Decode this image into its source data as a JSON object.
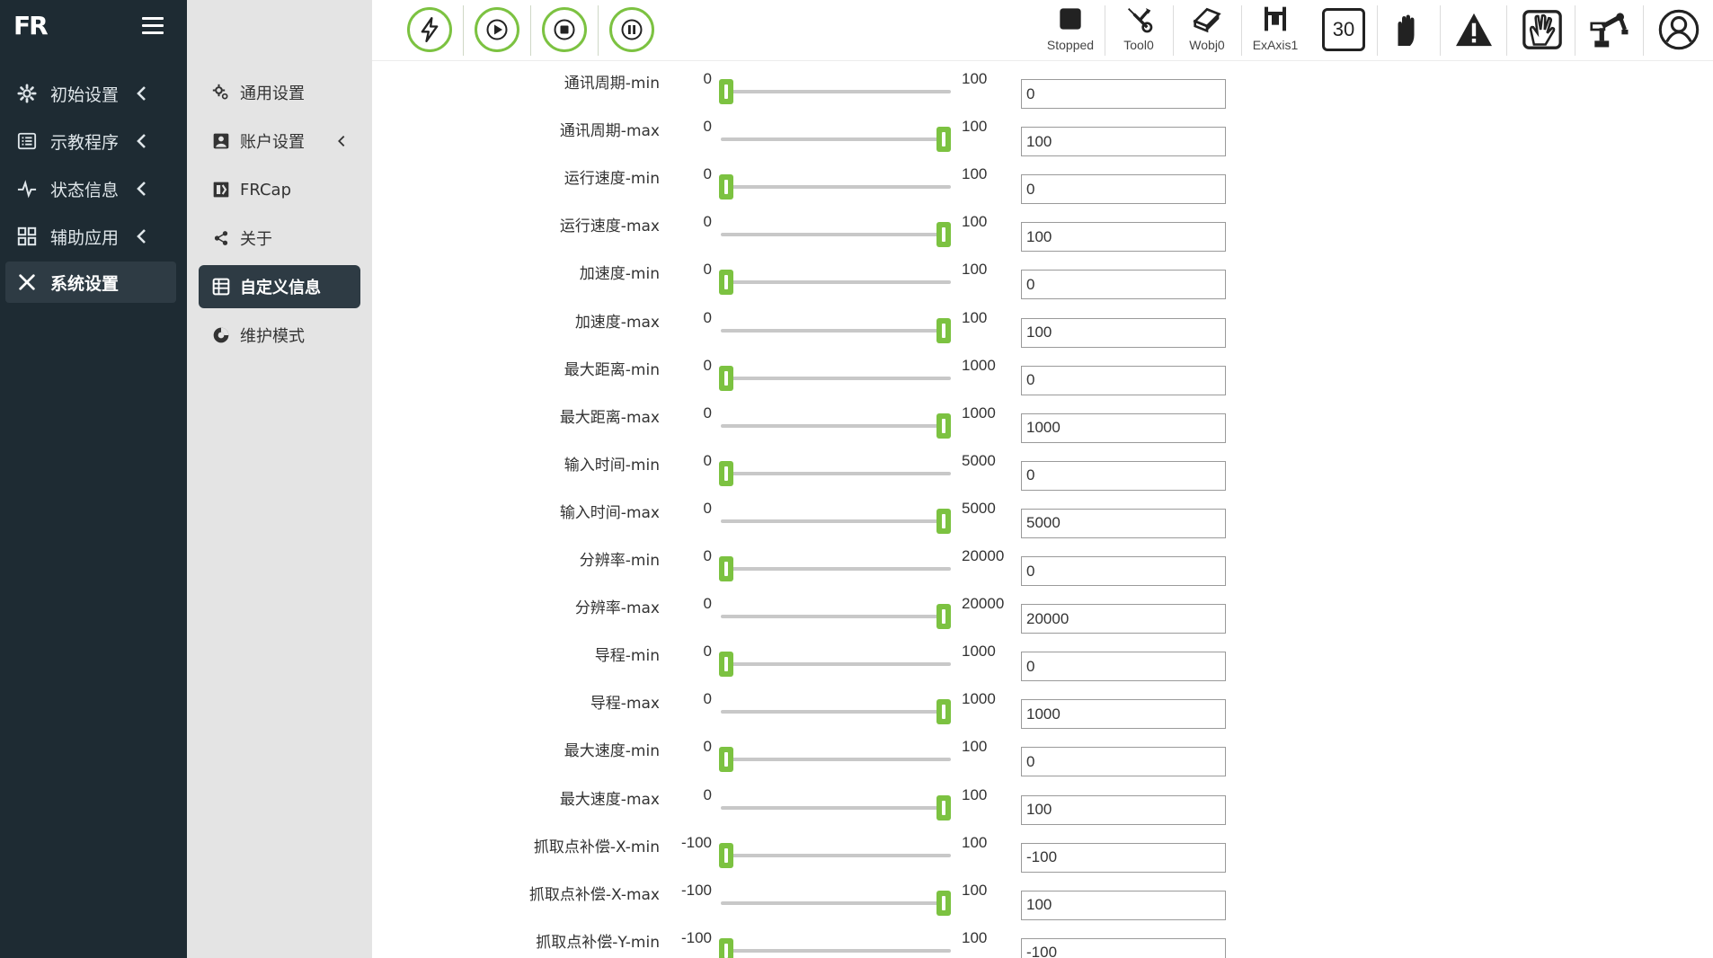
{
  "brand": {
    "logo": "FR"
  },
  "sidebar": {
    "items": [
      {
        "label": "初始设置",
        "icon": "gear-icon"
      },
      {
        "label": "示教程序",
        "icon": "list-icon"
      },
      {
        "label": "状态信息",
        "icon": "pulse-icon"
      },
      {
        "label": "辅助应用",
        "icon": "grid-icon"
      },
      {
        "label": "系统设置",
        "icon": "tools-icon",
        "active": true
      }
    ]
  },
  "submenu": {
    "items": [
      {
        "label": "通用设置",
        "icon": "gears-icon"
      },
      {
        "label": "账户设置",
        "icon": "account-icon",
        "chevron": true
      },
      {
        "label": "FRCap",
        "icon": "frcap-icon"
      },
      {
        "label": "关于",
        "icon": "share-icon"
      },
      {
        "label": "自定义信息",
        "icon": "table-icon",
        "active": true
      },
      {
        "label": "维护模式",
        "icon": "maintenance-icon"
      }
    ]
  },
  "toolbar": {
    "controls": [
      "lightning-icon",
      "play-icon",
      "stop-icon",
      "pause-icon"
    ],
    "status": [
      {
        "label": "Stopped",
        "icon": "stopped-square-icon"
      },
      {
        "label": "Tool0",
        "icon": "wrench-icon"
      },
      {
        "label": "Wobj0",
        "icon": "eraser-icon"
      },
      {
        "label": "ExAxis1",
        "icon": "ex-axis-icon"
      }
    ],
    "speed": "30"
  },
  "colors": {
    "accent": "#7cc241",
    "sidebar_bg": "#1e2b33",
    "submenu_bg": "#e4e4e4",
    "active_bg": "#2e3b44"
  },
  "params": [
    {
      "label": "通讯周期-min",
      "min": "0",
      "max": "100",
      "value": "0",
      "fraction": 0
    },
    {
      "label": "通讯周期-max",
      "min": "0",
      "max": "100",
      "value": "100",
      "fraction": 1
    },
    {
      "label": "运行速度-min",
      "min": "0",
      "max": "100",
      "value": "0",
      "fraction": 0
    },
    {
      "label": "运行速度-max",
      "min": "0",
      "max": "100",
      "value": "100",
      "fraction": 1
    },
    {
      "label": "加速度-min",
      "min": "0",
      "max": "100",
      "value": "0",
      "fraction": 0
    },
    {
      "label": "加速度-max",
      "min": "0",
      "max": "100",
      "value": "100",
      "fraction": 1
    },
    {
      "label": "最大距离-min",
      "min": "0",
      "max": "1000",
      "value": "0",
      "fraction": 0
    },
    {
      "label": "最大距离-max",
      "min": "0",
      "max": "1000",
      "value": "1000",
      "fraction": 1
    },
    {
      "label": "输入时间-min",
      "min": "0",
      "max": "5000",
      "value": "0",
      "fraction": 0
    },
    {
      "label": "输入时间-max",
      "min": "0",
      "max": "5000",
      "value": "5000",
      "fraction": 1
    },
    {
      "label": "分辨率-min",
      "min": "0",
      "max": "20000",
      "value": "0",
      "fraction": 0
    },
    {
      "label": "分辨率-max",
      "min": "0",
      "max": "20000",
      "value": "20000",
      "fraction": 1
    },
    {
      "label": "导程-min",
      "min": "0",
      "max": "1000",
      "value": "0",
      "fraction": 0
    },
    {
      "label": "导程-max",
      "min": "0",
      "max": "1000",
      "value": "1000",
      "fraction": 1
    },
    {
      "label": "最大速度-min",
      "min": "0",
      "max": "100",
      "value": "0",
      "fraction": 0
    },
    {
      "label": "最大速度-max",
      "min": "0",
      "max": "100",
      "value": "100",
      "fraction": 1
    },
    {
      "label": "抓取点补偿-X-min",
      "min": "-100",
      "max": "100",
      "value": "-100",
      "fraction": 0
    },
    {
      "label": "抓取点补偿-X-max",
      "min": "-100",
      "max": "100",
      "value": "100",
      "fraction": 1
    },
    {
      "label": "抓取点补偿-Y-min",
      "min": "-100",
      "max": "100",
      "value": "-100",
      "fraction": 0
    }
  ]
}
